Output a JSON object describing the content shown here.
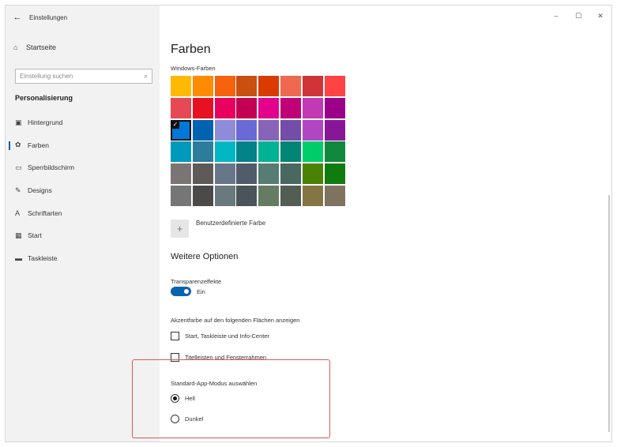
{
  "window": {
    "title": "Einstellungen",
    "controls": {
      "minimize": "–",
      "maximize": "☐",
      "close": "✕"
    }
  },
  "sidebar": {
    "back_glyph": "←",
    "home_label": "Startseite",
    "search_placeholder": "Einstellung suchen",
    "section_title": "Personalisierung",
    "items": [
      {
        "label": "Hintergrund",
        "icon": "image-icon",
        "glyph": "▣"
      },
      {
        "label": "Farben",
        "icon": "palette-icon",
        "glyph": "✿"
      },
      {
        "label": "Sperrbildschirm",
        "icon": "lockscreen-icon",
        "glyph": "▭"
      },
      {
        "label": "Designs",
        "icon": "brush-icon",
        "glyph": "✎"
      },
      {
        "label": "Schriftarten",
        "icon": "font-icon",
        "glyph": "A"
      },
      {
        "label": "Start",
        "icon": "start-icon",
        "glyph": "▦"
      },
      {
        "label": "Taskleiste",
        "icon": "taskbar-icon",
        "glyph": "▬"
      }
    ],
    "active_item": "Farben"
  },
  "main": {
    "title": "Farben",
    "windows_colors_label": "Windows-Farben",
    "swatches": [
      "#ffb900",
      "#ff8c00",
      "#f7630c",
      "#ca5010",
      "#da3b01",
      "#ef6950",
      "#d13438",
      "#ff4343",
      "#e74856",
      "#e81123",
      "#ea005e",
      "#c30052",
      "#e3008c",
      "#bf0077",
      "#c239b3",
      "#9a0089",
      "#0078d7",
      "#0063b1",
      "#8e8cd8",
      "#6b69d6",
      "#8764b8",
      "#744da9",
      "#b146c2",
      "#881798",
      "#0099bc",
      "#2d7d9a",
      "#00b7c3",
      "#038387",
      "#00b294",
      "#018574",
      "#00cc6a",
      "#10893e",
      "#7a7574",
      "#5d5a58",
      "#68768a",
      "#515c6b",
      "#567c73",
      "#486860",
      "#498205",
      "#107c10",
      "#767676",
      "#4c4a48",
      "#69797e",
      "#4a5459",
      "#647c64",
      "#525e54",
      "#847545",
      "#7e735f"
    ],
    "selected_swatch_index": 16,
    "check_glyph": "✓",
    "custom_color_label": "Benutzerdefinierte Farbe",
    "plus_glyph": "+",
    "more_options_title": "Weitere Optionen",
    "transparency_label": "Transparenzeffekte",
    "transparency_state": "Ein",
    "accent_surfaces_label": "Akzentfarbe auf den folgenden Flächen anzeigen",
    "checkbox_start": "Start, Taskleiste und Info-Center",
    "checkbox_titlebars": "Titelleisten und Fensterrahmen",
    "app_mode_label": "Standard-App-Modus auswählen",
    "radio_light": "Hell",
    "radio_dark": "Dunkel",
    "app_mode_selected": "Hell"
  },
  "colors": {
    "accent": "#0a64ad",
    "highlight_box": "#d65a5a",
    "sidebar_bg": "#f2f2f2"
  }
}
